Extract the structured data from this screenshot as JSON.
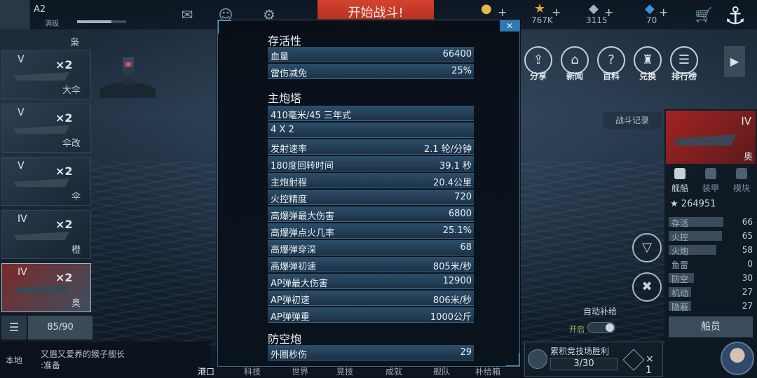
{
  "topbar": {
    "level": "A2",
    "level_sub": "满级",
    "start_battle": "开始战斗!",
    "resources": [
      {
        "icon": "gold-icon",
        "value": ""
      },
      {
        "icon": "star-icon",
        "value": "767K"
      },
      {
        "icon": "diamond-icon",
        "value": "3115"
      },
      {
        "icon": "blue-gem-icon",
        "value": "70"
      }
    ]
  },
  "left_ships": [
    {
      "tier": "V",
      "count": "×2",
      "name": "大伞"
    },
    {
      "tier": "V",
      "count": "×2",
      "name": "伞改"
    },
    {
      "tier": "V",
      "count": "×2",
      "name": "伞"
    },
    {
      "tier": "IV",
      "count": "×2",
      "name": "橙"
    },
    {
      "tier": "IV",
      "count": "×2",
      "name": "奥"
    }
  ],
  "left_top_label": "枭",
  "ship_count": "85/90",
  "chat": {
    "channel": "本地",
    "message_line1": "又眉又爱养的猴子舰长",
    "message_line2": ":准备"
  },
  "bottom_nav": [
    "港口",
    "科技",
    "世界",
    "竞技",
    "成就",
    "舰队",
    "补给箱"
  ],
  "right_nav": [
    "分享",
    "新闻",
    "百科",
    "兑换",
    "排行榜"
  ],
  "battle_log": "战斗记录",
  "right_panel": {
    "ship_tier": "IV",
    "ship_name": "奥",
    "tabs": [
      "舰船",
      "装甲",
      "模块"
    ],
    "rating": "264951",
    "stats": [
      {
        "label": "存活",
        "value": "66"
      },
      {
        "label": "火控",
        "value": "65"
      },
      {
        "label": "火炮",
        "value": "58"
      },
      {
        "label": "鱼雷",
        "value": "0"
      },
      {
        "label": "防空",
        "value": "30"
      },
      {
        "label": "机动",
        "value": "27"
      },
      {
        "label": "隐蔽",
        "value": "27"
      }
    ],
    "crew_button": "船员"
  },
  "auto_supply": {
    "title": "自动补给",
    "state": "开启"
  },
  "arena": {
    "title": "累积竞技场胜利",
    "progress": "3/30",
    "multiplier": "× 1"
  },
  "modal": {
    "close": "✕",
    "sections": [
      {
        "title": "存活性",
        "rows": [
          {
            "k": "血量",
            "v": "66400"
          },
          {
            "k": "雷伤减免",
            "v": "25%"
          }
        ]
      },
      {
        "title": "主炮塔",
        "rows": [
          {
            "k": "410毫米/45 三年式",
            "v": ""
          },
          {
            "k": "4 X 2",
            "v": ""
          },
          {
            "k": "发射速率",
            "v": "2.1 轮/分钟"
          },
          {
            "k": "180度回转时间",
            "v": "39.1 秒"
          },
          {
            "k": "主炮射程",
            "v": "20.4公里"
          },
          {
            "k": "火控精度",
            "v": "720"
          },
          {
            "k": "高爆弹最大伤害",
            "v": "6800"
          },
          {
            "k": "高爆弹点火几率",
            "v": "25.1%"
          },
          {
            "k": "高爆弹穿深",
            "v": "68"
          },
          {
            "k": "高爆弹初速",
            "v": "805米/秒"
          },
          {
            "k": "AP弹最大伤害",
            "v": "12900"
          },
          {
            "k": "AP弹初速",
            "v": "806米/秒"
          },
          {
            "k": "AP弹弹重",
            "v": "1000公斤"
          }
        ]
      },
      {
        "title": "防空炮",
        "rows": [
          {
            "k": "外圈秒伤",
            "v": "29"
          }
        ]
      }
    ]
  }
}
